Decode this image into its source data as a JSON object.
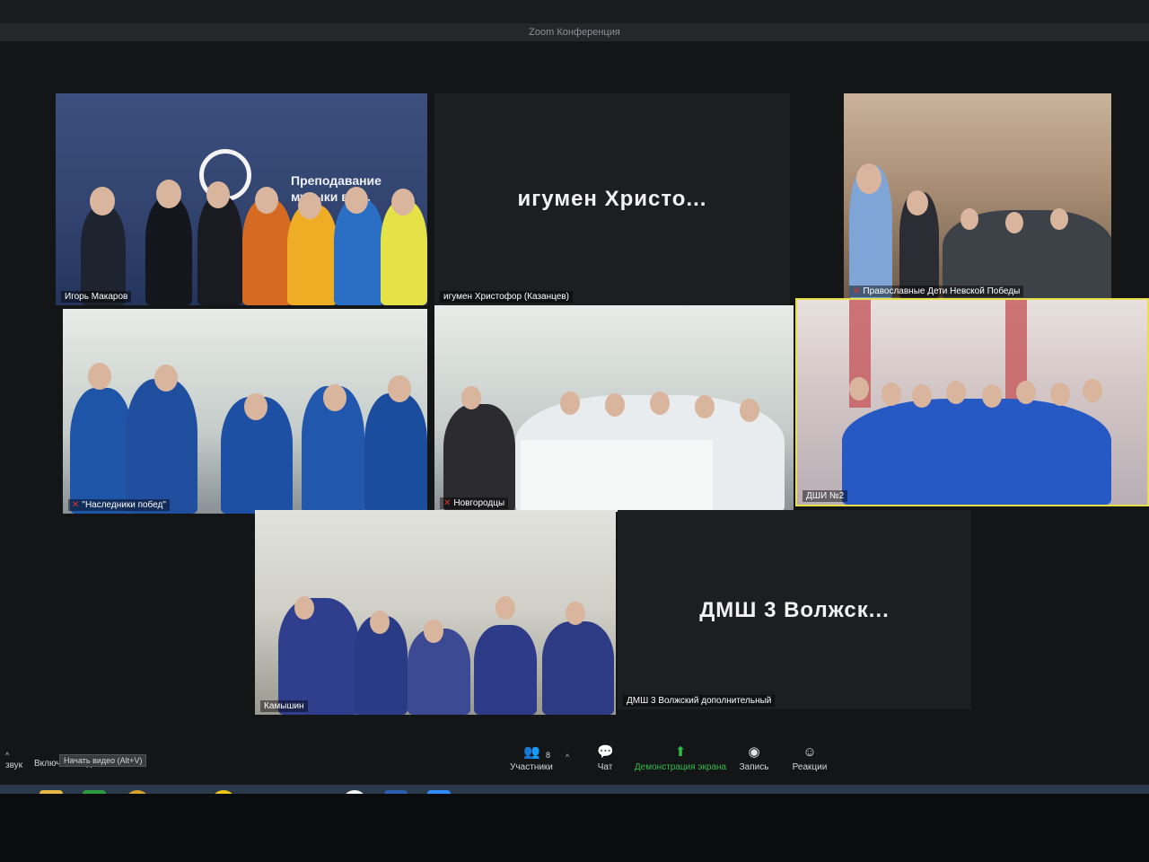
{
  "window": {
    "title": "Zoom Конференция"
  },
  "tiles": [
    {
      "id": "t1",
      "name": "Игорь Макаров",
      "muted": false,
      "type": "video",
      "banner": [
        "Преподавание",
        "музыки в ц..."
      ]
    },
    {
      "id": "t2",
      "name": "игумен Христофор (Казанцев)",
      "display_name": "игумен Христо...",
      "muted": false,
      "type": "name"
    },
    {
      "id": "t3",
      "name": "Православные Дети Невской Победы",
      "muted": true,
      "type": "video"
    },
    {
      "id": "t4",
      "name": "\"Наследники побед\"",
      "muted": true,
      "type": "video"
    },
    {
      "id": "t5",
      "name": "Новгородцы",
      "muted": true,
      "type": "video"
    },
    {
      "id": "t6",
      "name": "ДШИ №2",
      "muted": false,
      "type": "video",
      "active_speaker": true
    },
    {
      "id": "t7",
      "name": "Камышин",
      "muted": false,
      "type": "video"
    },
    {
      "id": "t8",
      "name": "ДМШ 3 Волжский дополнительный",
      "display_name": "ДМШ 3 Волжск...",
      "muted": false,
      "type": "name"
    }
  ],
  "toolbar": {
    "left_label_1": "звук",
    "left_label_2": "Включить видео",
    "tooltip": "Начать видео (Alt+V)",
    "participants_label": "Участники",
    "participants_count": "8",
    "chat_label": "Чат",
    "share_label": "Демонстрация экрана",
    "record_label": "Запись",
    "reactions_label": "Реакции"
  },
  "taskbar": {
    "apps": [
      "start",
      "file-explorer",
      "store",
      "chrome",
      "opera",
      "norton",
      "yandex",
      "edge",
      "yandex-browser",
      "word",
      "zoom"
    ]
  },
  "colors": {
    "active_border": "#e8e04a",
    "share_green": "#2fbb4f",
    "mute_red": "#e0322d"
  }
}
